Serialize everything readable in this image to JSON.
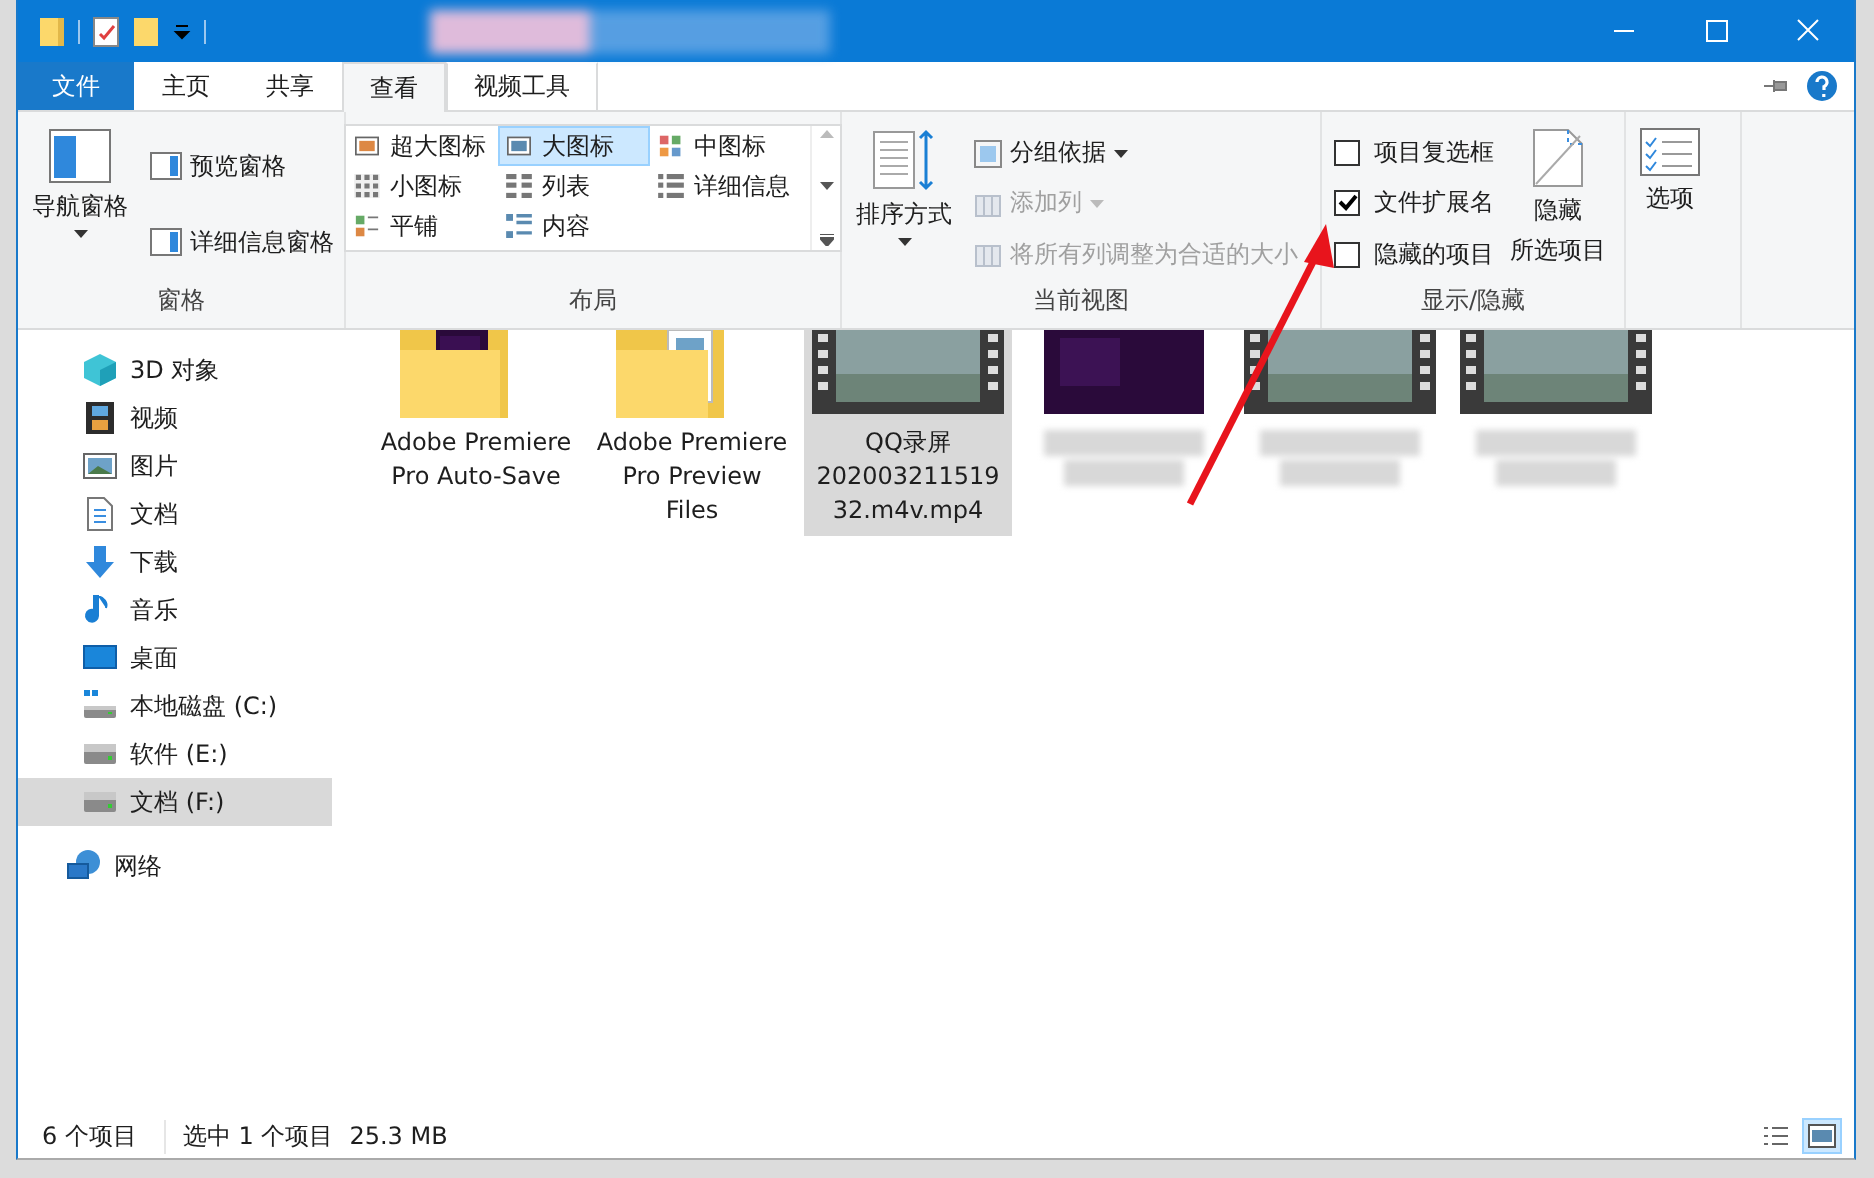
{
  "ribbon_tabs": [
    {
      "label": "文件",
      "kind": "file",
      "selected": false
    },
    {
      "label": "主页",
      "kind": "tab",
      "selected": false
    },
    {
      "label": "共享",
      "kind": "tab",
      "selected": false
    },
    {
      "label": "查看",
      "kind": "tab",
      "selected": true
    },
    {
      "label": "视频工具",
      "kind": "context",
      "selected": false
    }
  ],
  "panes_group": {
    "title": "窗格",
    "navigation_pane": "导航窗格",
    "preview_pane": "预览窗格",
    "details_pane": "详细信息窗格"
  },
  "layout_group": {
    "title": "布局",
    "options": [
      {
        "label": "超大图标",
        "kind": "xl",
        "selected": false
      },
      {
        "label": "大图标",
        "kind": "large",
        "selected": true
      },
      {
        "label": "中图标",
        "kind": "medium",
        "selected": false
      },
      {
        "label": "小图标",
        "kind": "small",
        "selected": false
      },
      {
        "label": "列表",
        "kind": "list",
        "selected": false
      },
      {
        "label": "详细信息",
        "kind": "details",
        "selected": false
      },
      {
        "label": "平铺",
        "kind": "tiles",
        "selected": false
      },
      {
        "label": "内容",
        "kind": "content",
        "selected": false
      }
    ]
  },
  "current_view_group": {
    "title": "当前视图",
    "sort_by": "排序方式",
    "group_by": "分组依据",
    "add_columns": {
      "label": "添加列",
      "disabled": true
    },
    "size_columns": {
      "label": "将所有列调整为合适的大小",
      "disabled": true
    }
  },
  "show_hide_group": {
    "title": "显示/隐藏",
    "checkboxes": [
      {
        "label": "项目复选框",
        "checked": false
      },
      {
        "label": "文件扩展名",
        "checked": true
      },
      {
        "label": "隐藏的项目",
        "checked": false
      }
    ],
    "hide_selected": [
      "隐藏",
      "所选项目"
    ]
  },
  "options_group": {
    "label": "选项"
  },
  "nav_pane": {
    "items": [
      {
        "label": "3D 对象",
        "kind": "cube",
        "selected": false
      },
      {
        "label": "视频",
        "kind": "video",
        "selected": false
      },
      {
        "label": "图片",
        "kind": "picture",
        "selected": false
      },
      {
        "label": "文档",
        "kind": "document",
        "selected": false
      },
      {
        "label": "下载",
        "kind": "download",
        "selected": false
      },
      {
        "label": "音乐",
        "kind": "music",
        "selected": false
      },
      {
        "label": "桌面",
        "kind": "desktop",
        "selected": false
      },
      {
        "label": "本地磁盘 (C:)",
        "kind": "system-drive",
        "selected": false
      },
      {
        "label": "软件 (E:)",
        "kind": "drive",
        "selected": false
      },
      {
        "label": "文档 (F:)",
        "kind": "drive",
        "selected": true
      },
      {
        "label": "网络",
        "kind": "network",
        "selected": false
      }
    ]
  },
  "files": [
    {
      "name": "Adobe Premiere Pro Auto-Save",
      "kind": "pr-folder",
      "selected": false
    },
    {
      "name": "Adobe Premiere Pro Preview Files",
      "kind": "folder",
      "selected": false
    },
    {
      "name": "QQ录屏20200321151932.m4v.mp4",
      "kind": "video",
      "selected": true
    },
    {
      "kind": "pr-file",
      "selected": false
    },
    {
      "kind": "video",
      "selected": false
    },
    {
      "kind": "video",
      "selected": false
    }
  ],
  "status_bar": {
    "item_count": "6 个项目",
    "selection": "选中 1 个项目",
    "size": "25.3 MB"
  }
}
